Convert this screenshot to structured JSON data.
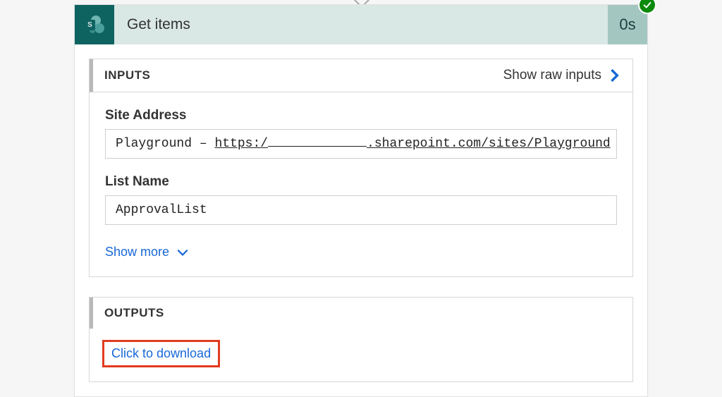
{
  "header": {
    "title": "Get items",
    "duration": "0s",
    "icon_letter": "S"
  },
  "inputs": {
    "section_label": "INPUTS",
    "raw_action": "Show raw inputs",
    "fields": {
      "site_address": {
        "label": "Site Address",
        "prefix": "Playground – ",
        "url_part1": "https:/",
        "url_part2": ".sharepoint.com/sites/Playground"
      },
      "list_name": {
        "label": "List Name",
        "value": "ApprovalList"
      }
    },
    "show_more": "Show more"
  },
  "outputs": {
    "section_label": "OUTPUTS",
    "download": "Click to download"
  }
}
